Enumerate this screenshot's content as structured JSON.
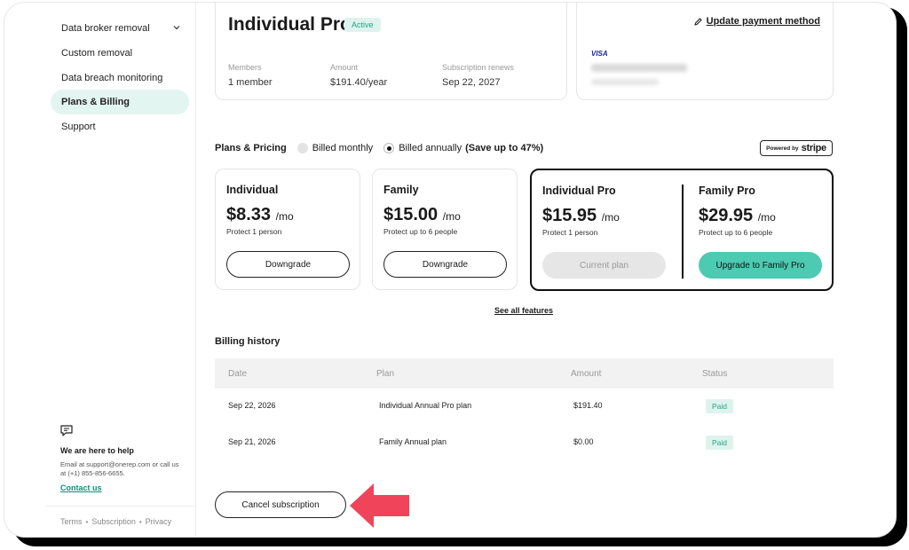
{
  "sidebar": {
    "items": [
      {
        "label": "Data broker removal"
      },
      {
        "label": "Custom removal"
      },
      {
        "label": "Data breach monitoring"
      },
      {
        "label": "Plans & Billing"
      },
      {
        "label": "Support"
      }
    ],
    "help": {
      "title": "We are here to help",
      "text": "Email at support@onerep.com or call us at (+1) 855-856-6655.",
      "link": "Contact us"
    },
    "footer": [
      "Terms",
      "Subscription",
      "Privacy"
    ]
  },
  "subscription": {
    "plan": "Individual Pro",
    "status": "Active",
    "members_label": "Members",
    "members_value": "1 member",
    "amount_label": "Amount",
    "amount_value": "$191.40/year",
    "renews_label": "Subscription renews",
    "renews_value": "Sep 22, 2027"
  },
  "payment": {
    "update_link": "Update payment method",
    "card_brand": "VISA"
  },
  "pricing": {
    "title": "Plans & Pricing",
    "monthly": "Billed monthly",
    "annually": "Billed annually",
    "save_note": "(Save up to 47%)",
    "powered_by": "Powered by",
    "stripe": "stripe",
    "plans": [
      {
        "name": "Individual",
        "price": "$8.33",
        "unit": "/mo",
        "desc": "Protect 1 person",
        "button": "Downgrade"
      },
      {
        "name": "Family",
        "price": "$15.00",
        "unit": "/mo",
        "desc": "Protect up to 6 people",
        "button": "Downgrade"
      },
      {
        "name": "Individual Pro",
        "price": "$15.95",
        "unit": "/mo",
        "desc": "Protect 1 person",
        "button": "Current plan"
      },
      {
        "name": "Family Pro",
        "price": "$29.95",
        "unit": "/mo",
        "desc": "Protect up to 6 people",
        "button": "Upgrade to Family Pro"
      }
    ],
    "see_all": "See all features"
  },
  "billing": {
    "title": "Billing history",
    "columns": [
      "Date",
      "Plan",
      "Amount",
      "Status"
    ],
    "rows": [
      {
        "date": "Sep 22, 2026",
        "plan": "Individual Annual Pro plan",
        "amount": "$191.40",
        "status": "Paid"
      },
      {
        "date": "Sep 21, 2026",
        "plan": "Family Annual plan",
        "amount": "$0.00",
        "status": "Paid"
      }
    ]
  },
  "cancel_label": "Cancel subscription",
  "colors": {
    "accent": "#4ccab2",
    "badge_bg": "#dff3ee",
    "arrow": "#f0445a"
  }
}
